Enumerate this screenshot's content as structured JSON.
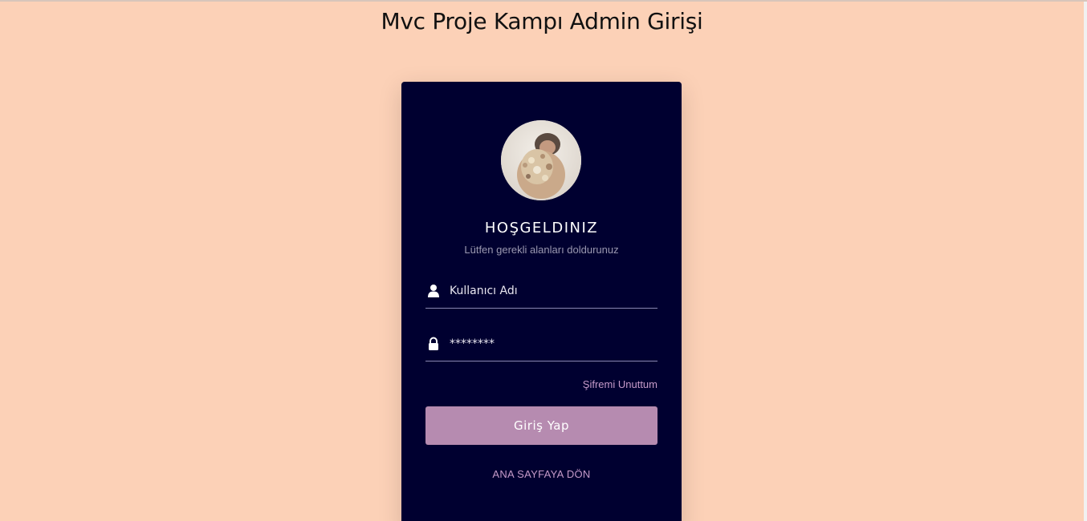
{
  "page": {
    "title": "Mvc Proje Kampı Admin Girişi"
  },
  "login_card": {
    "avatar_icon": "user-photo",
    "welcome": "HOŞGELDINIZ",
    "subtitle": "Lütfen gerekli alanları doldurunuz",
    "username": {
      "icon": "user-icon",
      "placeholder": "Kullanıcı Adı",
      "value": ""
    },
    "password": {
      "icon": "lock-icon",
      "placeholder": "********",
      "value": ""
    },
    "forgot_password": "Şifremi Unuttum",
    "login_button": "Giriş Yap",
    "home_link": "ANA SAYFAYA DÖN"
  },
  "colors": {
    "background": "#fcd1b7",
    "card": "#000030",
    "accent": "#b68bb0",
    "link": "#c59ac8"
  }
}
